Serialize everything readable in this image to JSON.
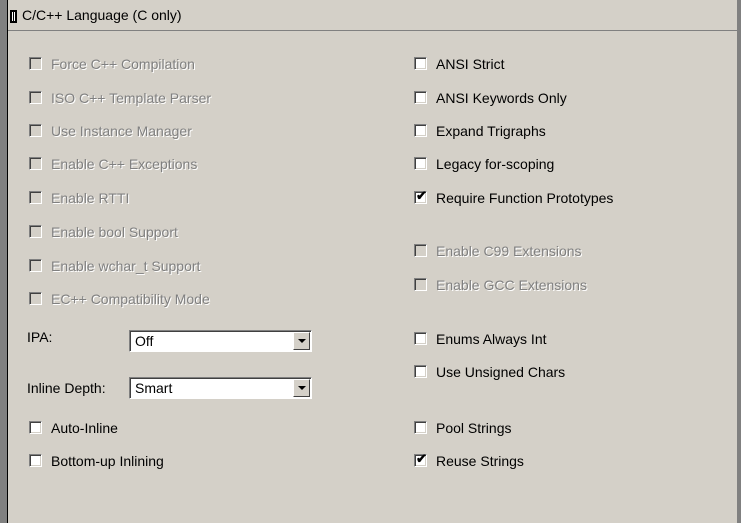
{
  "panel": {
    "title": "C/C++ Language (C only)"
  },
  "left": {
    "force_cpp": "Force C++ Compilation",
    "iso_template": "ISO C++ Template Parser",
    "instance_manager": "Use Instance Manager",
    "cpp_exceptions": "Enable C++ Exceptions",
    "rtti": "Enable RTTI",
    "bool_support": "Enable bool Support",
    "wchar_support": "Enable wchar_t Support",
    "ecpp_mode": "EC++ Compatibility Mode",
    "ipa_label": "IPA:",
    "ipa_value": "Off",
    "inline_label": "Inline Depth:",
    "inline_value": "Smart",
    "auto_inline": "Auto-Inline",
    "bottom_up": "Bottom-up Inlining"
  },
  "right": {
    "ansi_strict": "ANSI Strict",
    "ansi_keywords": "ANSI Keywords Only",
    "trigraphs": "Expand Trigraphs",
    "legacy_scoping": "Legacy for-scoping",
    "require_prototypes": "Require Function Prototypes",
    "c99": "Enable C99 Extensions",
    "gcc": "Enable GCC Extensions",
    "enums_int": "Enums Always Int",
    "unsigned_chars": "Use Unsigned Chars",
    "pool_strings": "Pool Strings",
    "reuse_strings": "Reuse Strings"
  },
  "state": {
    "require_prototypes_checked": true,
    "reuse_strings_checked": true
  },
  "icons": {
    "title_icon": "panel-grip-icon",
    "dropdown": "chevron-down-icon",
    "check": "checkmark-icon"
  }
}
